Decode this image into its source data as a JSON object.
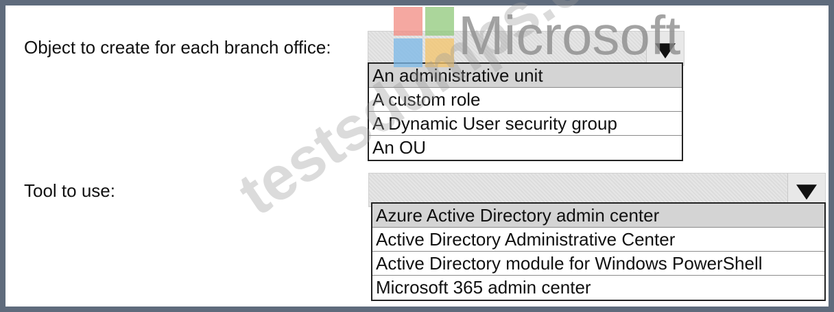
{
  "watermark": {
    "logo_text": "Microsoft",
    "site_text": "testsdumps.com",
    "logo_colors": [
      "#f25022",
      "#7fba00",
      "#00a4ef",
      "#ffb900"
    ]
  },
  "question1": {
    "label": "Object to create for each branch office:",
    "selected_value": "",
    "options": [
      "An administrative unit",
      "A custom role",
      "A Dynamic User security group",
      "An OU"
    ]
  },
  "question2": {
    "label": "Tool to use:",
    "selected_value": "",
    "options": [
      "Azure Active Directory admin center",
      "Active Directory Administrative Center",
      "Active Directory module for Windows PowerShell",
      "Microsoft 365 admin center"
    ]
  },
  "colors": {
    "frame": "#5f6b7c",
    "highlight": "#d4d4d4"
  }
}
